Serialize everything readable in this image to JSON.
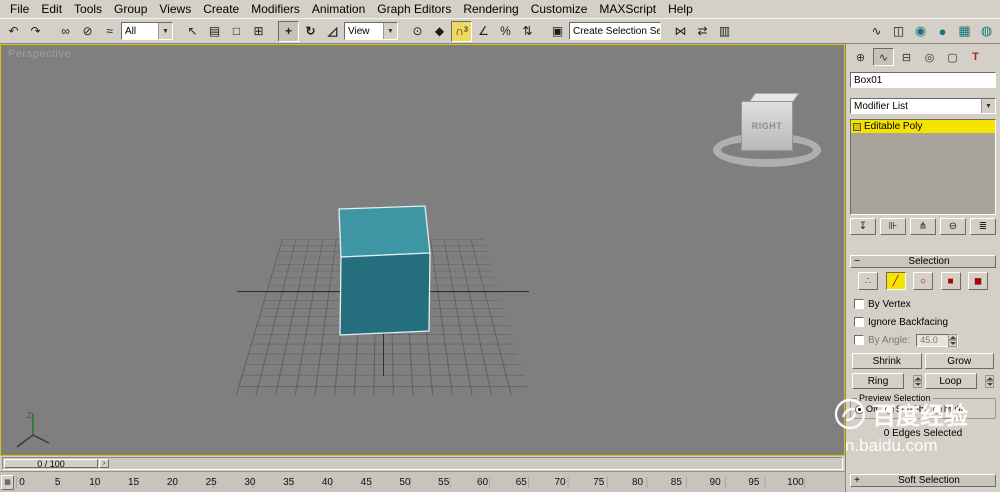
{
  "menu": {
    "items": [
      {
        "name": "menu-file",
        "label": "File"
      },
      {
        "name": "menu-edit",
        "label": "Edit"
      },
      {
        "name": "menu-tools",
        "label": "Tools"
      },
      {
        "name": "menu-group",
        "label": "Group"
      },
      {
        "name": "menu-views",
        "label": "Views"
      },
      {
        "name": "menu-create",
        "label": "Create"
      },
      {
        "name": "menu-modifiers",
        "label": "Modifiers"
      },
      {
        "name": "menu-animation",
        "label": "Animation"
      },
      {
        "name": "menu-graph-editors",
        "label": "Graph Editors"
      },
      {
        "name": "menu-rendering",
        "label": "Rendering"
      },
      {
        "name": "menu-customize",
        "label": "Customize"
      },
      {
        "name": "menu-maxscript",
        "label": "MAXScript"
      },
      {
        "name": "menu-help",
        "label": "Help"
      }
    ]
  },
  "toolbar": {
    "group_history": [
      {
        "name": "undo-icon",
        "glyph": "↶"
      },
      {
        "name": "redo-icon",
        "glyph": "↷"
      }
    ],
    "group_link": [
      {
        "name": "select-and-link-icon",
        "glyph": "∞"
      },
      {
        "name": "unlink-selection-icon",
        "glyph": "⊘"
      },
      {
        "name": "bind-to-spacewarp-icon",
        "glyph": "≈"
      }
    ],
    "selection_filter": {
      "value": "All"
    },
    "group_select": [
      {
        "name": "select-object-icon",
        "glyph": "↖"
      },
      {
        "name": "select-by-name-icon",
        "glyph": "▤"
      },
      {
        "name": "rect-selection-region-icon",
        "glyph": "□"
      },
      {
        "name": "window-crossing-icon",
        "glyph": "⊞"
      }
    ],
    "group_transform": [
      {
        "name": "select-and-move-icon",
        "glyph": "+",
        "active": true
      },
      {
        "name": "select-and-rotate-icon",
        "glyph": "↻"
      },
      {
        "name": "select-and-scale-icon",
        "glyph": "◿"
      }
    ],
    "ref_coord": {
      "value": "View"
    },
    "group_snap": [
      {
        "name": "use-pivot-center-icon",
        "glyph": "⊙"
      },
      {
        "name": "select-and-manipulate-icon",
        "glyph": "◆"
      },
      {
        "name": "snap-toggle-3d-icon",
        "glyph": "∩³",
        "highlight": true
      },
      {
        "name": "angle-snap-icon",
        "glyph": "∠"
      },
      {
        "name": "percent-snap-icon",
        "glyph": "%"
      },
      {
        "name": "spinner-snap-icon",
        "glyph": "⇅"
      }
    ],
    "group_named": [
      {
        "name": "edit-named-selections-icon",
        "glyph": "▣"
      }
    ],
    "named_selection": {
      "value": "Create Selection Se"
    },
    "group_tools": [
      {
        "name": "mirror-icon",
        "glyph": "⋈"
      },
      {
        "name": "align-icon",
        "glyph": "⇄"
      },
      {
        "name": "layer-manager-icon",
        "glyph": "▥"
      }
    ],
    "group_editors": [
      {
        "name": "curve-editor-icon",
        "glyph": "∿"
      },
      {
        "name": "schematic-view-icon",
        "glyph": "◫"
      },
      {
        "name": "material-editor-icon",
        "glyph": "◉",
        "cls": "teal"
      },
      {
        "name": "render-setup-icon",
        "glyph": "●",
        "cls": "teal"
      },
      {
        "name": "render-frame-icon",
        "glyph": "▦",
        "cls": "teal"
      },
      {
        "name": "quick-render-icon",
        "glyph": "◍",
        "cls": "teal"
      }
    ]
  },
  "viewport": {
    "label": "Perspective",
    "viewcube_face": "RIGHT"
  },
  "panel": {
    "tabs": [
      {
        "name": "tab-create",
        "glyph": "⊕"
      },
      {
        "name": "tab-modify",
        "glyph": "∿",
        "active": true
      },
      {
        "name": "tab-hierarchy",
        "glyph": "⊟"
      },
      {
        "name": "tab-motion",
        "glyph": "◎"
      },
      {
        "name": "tab-display",
        "glyph": "▢"
      },
      {
        "name": "tab-utilities",
        "glyph": "T"
      }
    ],
    "object_name": "Box01",
    "modifier_list_label": "Modifier List",
    "stack_selected": "Editable Poly",
    "stack_tools": [
      {
        "name": "pin-stack-icon",
        "glyph": "↧"
      },
      {
        "name": "show-end-result-icon",
        "glyph": "⊪"
      },
      {
        "name": "make-unique-icon",
        "glyph": "⋔"
      },
      {
        "name": "remove-modifier-icon",
        "glyph": "⊖"
      },
      {
        "name": "configure-modifier-sets-icon",
        "glyph": "≣"
      }
    ],
    "selection": {
      "collapse_glyph": "−",
      "title": "Selection",
      "subobject_icons": [
        {
          "name": "vertex-mode-icon",
          "glyph": "∴"
        },
        {
          "name": "edge-mode-icon",
          "glyph": "╱",
          "highlight": true
        },
        {
          "name": "border-mode-icon",
          "glyph": "○"
        },
        {
          "name": "polygon-mode-icon",
          "glyph": "■"
        },
        {
          "name": "element-mode-icon",
          "glyph": "◼"
        }
      ],
      "by_vertex": "By Vertex",
      "ignore_backfacing": "Ignore Backfacing",
      "by_angle_label": "By Angle:",
      "by_angle_value": "45.0",
      "shrink": "Shrink",
      "grow": "Grow",
      "ring": "Ring",
      "loop": "Loop",
      "preview_title": "Preview Selection",
      "radio_off": "Off",
      "radio_subobj": "SubObj",
      "radio_multi": "Multi",
      "status": "0 Edges Selected"
    },
    "expand_glyph": "+",
    "soft_selection_title": "Soft Selection"
  },
  "timeline": {
    "slider_label": "0 / 100",
    "next_frame_glyph": "›",
    "ticks": [
      "0",
      "5",
      "10",
      "15",
      "20",
      "25",
      "30",
      "35",
      "40",
      "45",
      "50",
      "55",
      "60",
      "65",
      "70",
      "75",
      "80",
      "85",
      "90",
      "95",
      "100"
    ]
  },
  "icons": {
    "dropdown_arrow": "▼",
    "trackbar_button": "▦"
  },
  "watermark": {
    "title": "百度经验",
    "domain": "n.baidu.com"
  },
  "colors": {
    "active_viewport_border": "#d8c500",
    "selection_highlight": "#f6e400",
    "box_top": "#3e95a4",
    "box_front": "#256e7e"
  }
}
